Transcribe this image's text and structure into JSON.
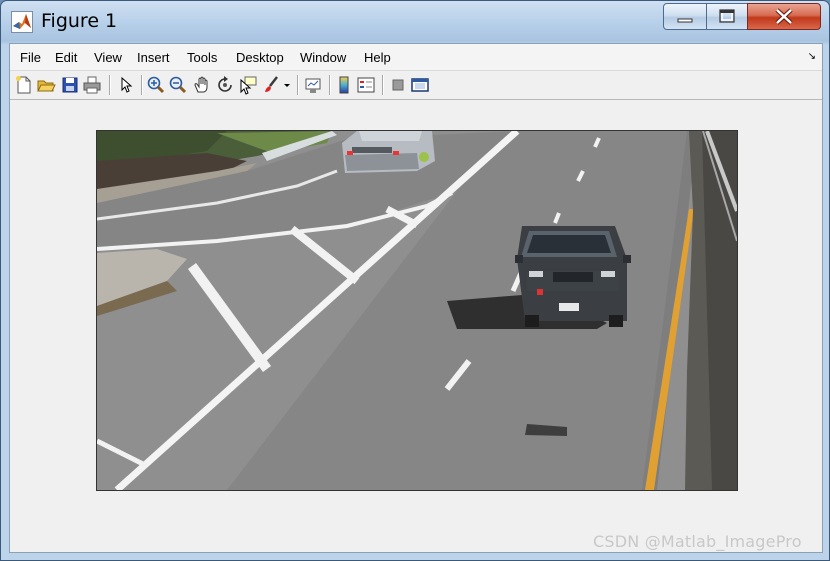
{
  "window": {
    "title": "Figure 1",
    "controls": {
      "minimize": "minimize",
      "maximize": "maximize",
      "close": "close"
    }
  },
  "menubar": {
    "items": [
      "File",
      "Edit",
      "View",
      "Insert",
      "Tools",
      "Desktop",
      "Window",
      "Help"
    ],
    "dock_arrow": "↘"
  },
  "toolbar": {
    "buttons": [
      "new-figure-icon",
      "open-file-icon",
      "save-icon",
      "print-icon",
      "edit-plot-arrow-icon",
      "zoom-in-icon",
      "zoom-out-icon",
      "pan-hand-icon",
      "rotate-3d-icon",
      "data-cursor-icon",
      "brush-icon",
      "brush-dropdown-icon",
      "link-plot-icon",
      "insert-colorbar-icon",
      "insert-legend-icon",
      "hide-plot-tools-icon",
      "show-plot-tools-icon"
    ]
  },
  "image": {
    "description_icon": "highway-traffic-photo"
  },
  "watermark": "CSDN @Matlab_ImagePro"
}
